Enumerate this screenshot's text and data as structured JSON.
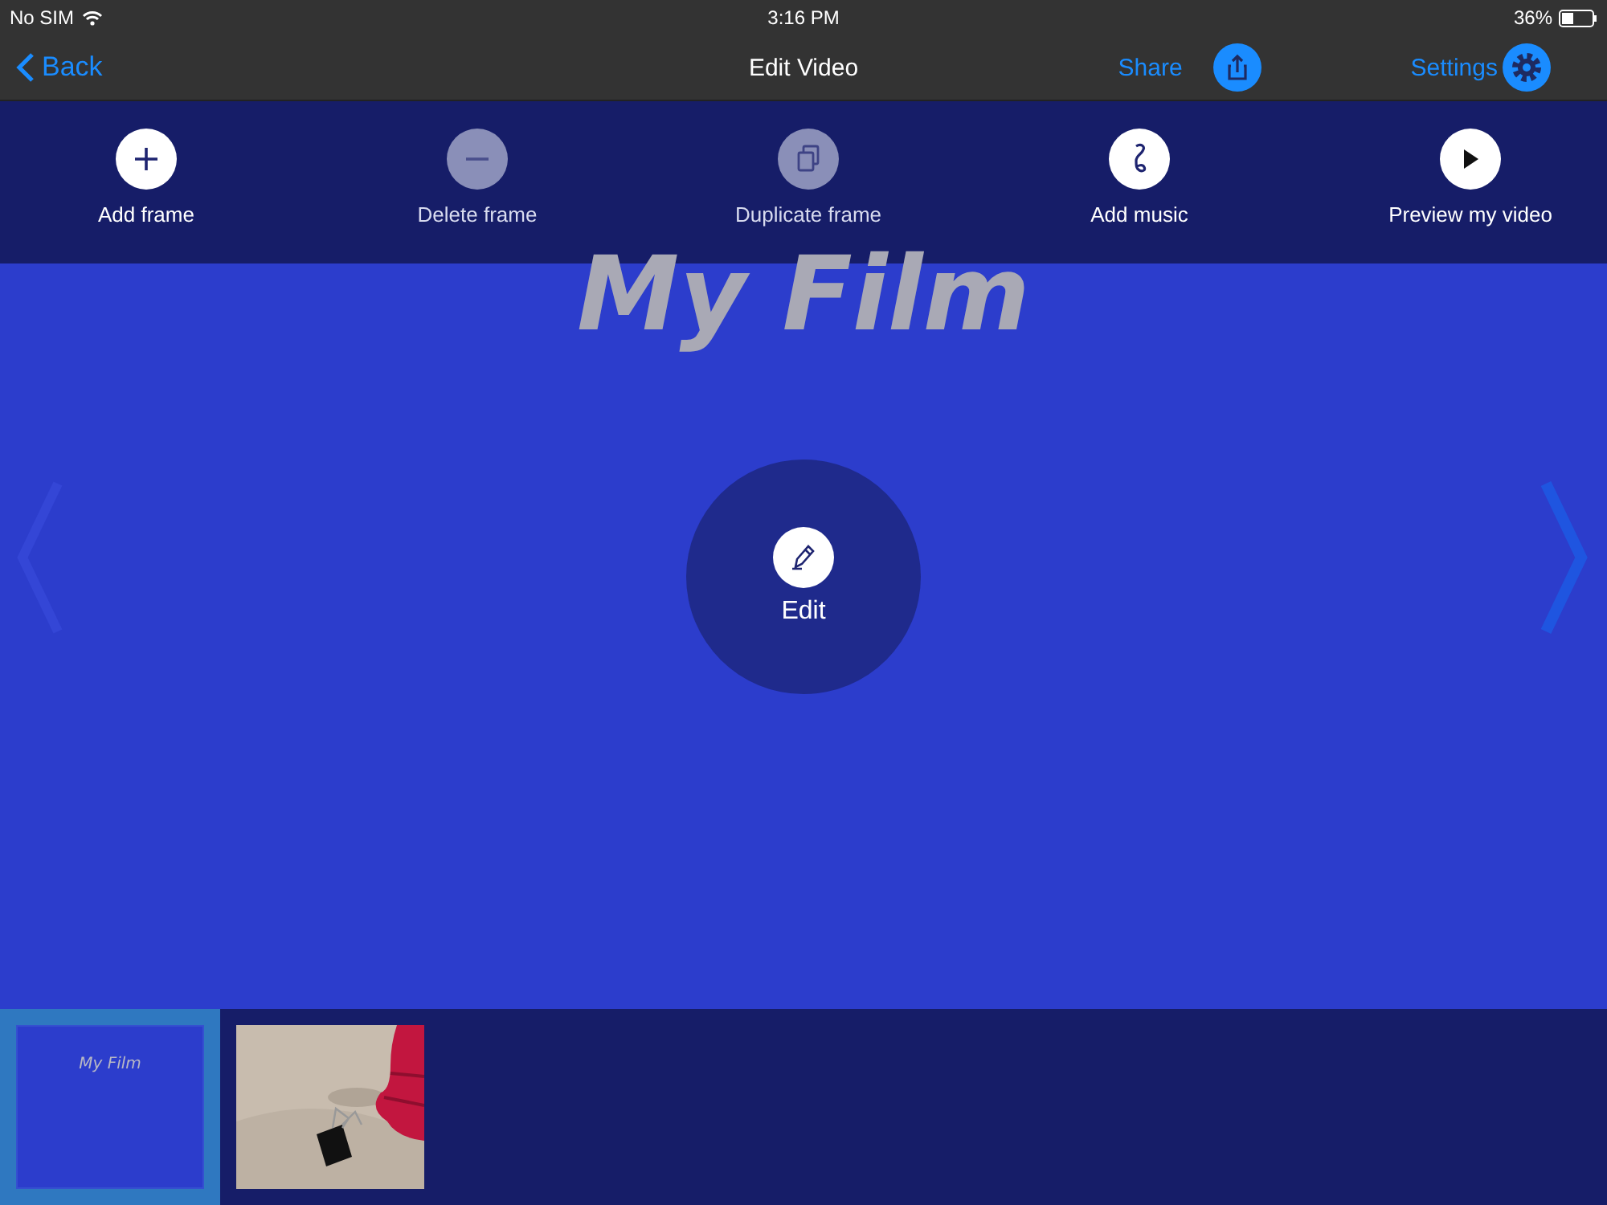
{
  "status_bar": {
    "carrier": "No SIM",
    "time": "3:16 PM",
    "battery": "36%"
  },
  "nav_bar": {
    "back": "Back",
    "title": "Edit Video",
    "share": "Share",
    "settings": "Settings"
  },
  "toolbar": [
    {
      "kind": "add",
      "label": "Add frame",
      "disabled": false
    },
    {
      "kind": "delete",
      "label": "Delete frame",
      "disabled": true
    },
    {
      "kind": "duplicate",
      "label": "Duplicate frame",
      "disabled": true
    },
    {
      "kind": "music",
      "label": "Add music",
      "disabled": false
    },
    {
      "kind": "play",
      "label": "Preview my video",
      "disabled": false
    }
  ],
  "frame": {
    "title": "My Film",
    "edit": "Edit"
  },
  "filmstrip": [
    {
      "kind": "title",
      "title": "My Film",
      "selected": true
    },
    {
      "kind": "picture",
      "selected": false
    }
  ]
}
